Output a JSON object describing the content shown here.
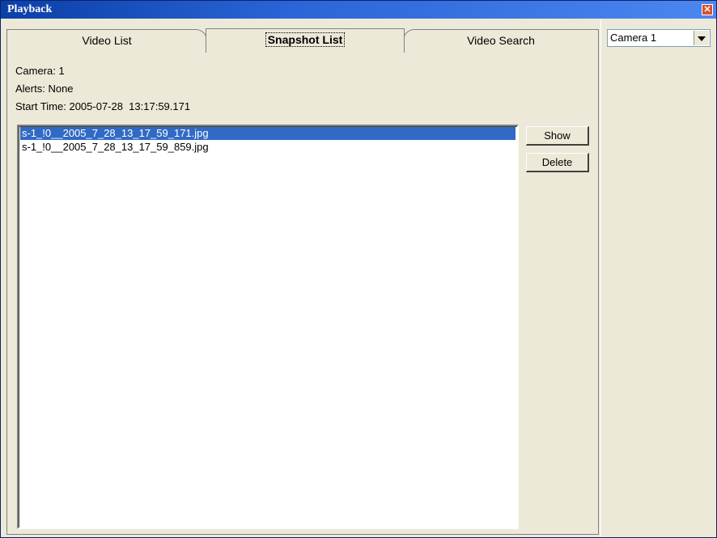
{
  "window": {
    "title": "Playback",
    "close_label": "✕"
  },
  "tabs": [
    {
      "label": "Video List"
    },
    {
      "label": "Snapshot List"
    },
    {
      "label": "Video Search"
    }
  ],
  "info": {
    "camera": "Camera: 1",
    "alerts": "Alerts: None",
    "start_time": "Start Time: 2005-07-28  13:17:59.171"
  },
  "files": [
    {
      "name": "s-1_!0__2005_7_28_13_17_59_171.jpg",
      "selected": true
    },
    {
      "name": "s-1_!0__2005_7_28_13_17_59_859.jpg",
      "selected": false
    }
  ],
  "buttons": {
    "show": "Show",
    "delete": "Delete"
  },
  "camera_select": {
    "value": "Camera 1"
  },
  "colors": {
    "title_bar": "#2A64D6",
    "selection": "#316AC5",
    "face": "#ECE9D8"
  }
}
